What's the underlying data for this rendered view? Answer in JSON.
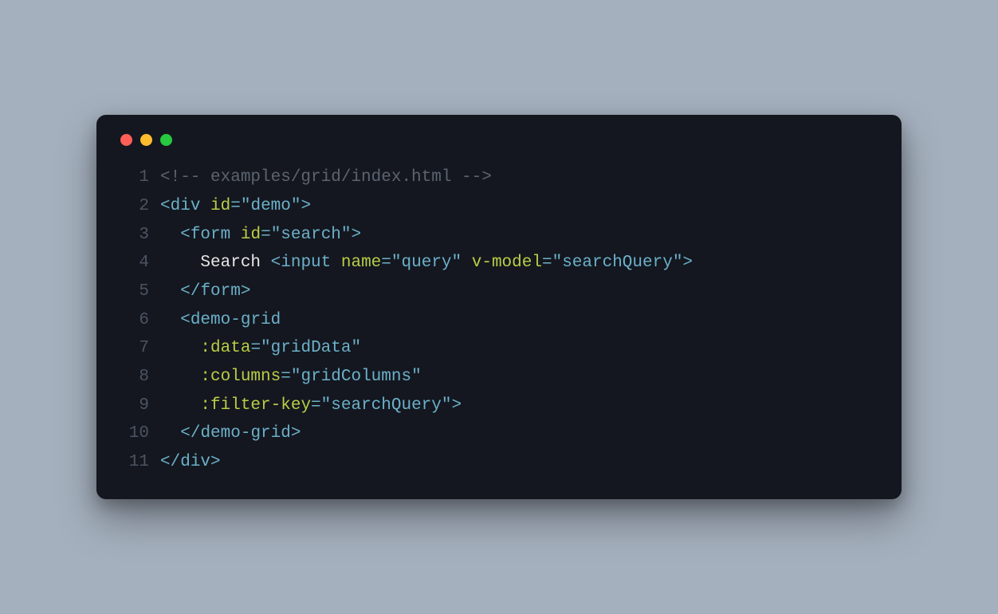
{
  "lines": [
    {
      "n": "1",
      "tokens": [
        {
          "c": "tok-comment",
          "t": "<!-- examples/grid/index.html -->"
        }
      ]
    },
    {
      "n": "2",
      "tokens": [
        {
          "c": "tok-punct",
          "t": "<"
        },
        {
          "c": "tok-tag",
          "t": "div"
        },
        {
          "c": "",
          "t": " "
        },
        {
          "c": "tok-attr",
          "t": "id"
        },
        {
          "c": "tok-punct",
          "t": "="
        },
        {
          "c": "tok-punct",
          "t": "\""
        },
        {
          "c": "tok-string",
          "t": "demo"
        },
        {
          "c": "tok-punct",
          "t": "\""
        },
        {
          "c": "tok-punct",
          "t": ">"
        }
      ]
    },
    {
      "n": "3",
      "tokens": [
        {
          "c": "",
          "t": "  "
        },
        {
          "c": "tok-punct",
          "t": "<"
        },
        {
          "c": "tok-tag",
          "t": "form"
        },
        {
          "c": "",
          "t": " "
        },
        {
          "c": "tok-attr",
          "t": "id"
        },
        {
          "c": "tok-punct",
          "t": "="
        },
        {
          "c": "tok-punct",
          "t": "\""
        },
        {
          "c": "tok-string",
          "t": "search"
        },
        {
          "c": "tok-punct",
          "t": "\""
        },
        {
          "c": "tok-punct",
          "t": ">"
        }
      ]
    },
    {
      "n": "4",
      "tokens": [
        {
          "c": "",
          "t": "    "
        },
        {
          "c": "tok-text",
          "t": "Search "
        },
        {
          "c": "tok-punct",
          "t": "<"
        },
        {
          "c": "tok-tag",
          "t": "input"
        },
        {
          "c": "",
          "t": " "
        },
        {
          "c": "tok-attr",
          "t": "name"
        },
        {
          "c": "tok-punct",
          "t": "="
        },
        {
          "c": "tok-punct",
          "t": "\""
        },
        {
          "c": "tok-string",
          "t": "query"
        },
        {
          "c": "tok-punct",
          "t": "\""
        },
        {
          "c": "",
          "t": " "
        },
        {
          "c": "tok-attr",
          "t": "v-model"
        },
        {
          "c": "tok-punct",
          "t": "="
        },
        {
          "c": "tok-punct",
          "t": "\""
        },
        {
          "c": "tok-string",
          "t": "searchQuery"
        },
        {
          "c": "tok-punct",
          "t": "\""
        },
        {
          "c": "tok-punct",
          "t": ">"
        }
      ]
    },
    {
      "n": "5",
      "tokens": [
        {
          "c": "",
          "t": "  "
        },
        {
          "c": "tok-punct",
          "t": "</"
        },
        {
          "c": "tok-tag",
          "t": "form"
        },
        {
          "c": "tok-punct",
          "t": ">"
        }
      ]
    },
    {
      "n": "6",
      "tokens": [
        {
          "c": "",
          "t": "  "
        },
        {
          "c": "tok-punct",
          "t": "<"
        },
        {
          "c": "tok-tag",
          "t": "demo-grid"
        }
      ]
    },
    {
      "n": "7",
      "tokens": [
        {
          "c": "",
          "t": "    "
        },
        {
          "c": "tok-attr",
          "t": ":data"
        },
        {
          "c": "tok-punct",
          "t": "="
        },
        {
          "c": "tok-punct",
          "t": "\""
        },
        {
          "c": "tok-string",
          "t": "gridData"
        },
        {
          "c": "tok-punct",
          "t": "\""
        }
      ]
    },
    {
      "n": "8",
      "tokens": [
        {
          "c": "",
          "t": "    "
        },
        {
          "c": "tok-attr",
          "t": ":columns"
        },
        {
          "c": "tok-punct",
          "t": "="
        },
        {
          "c": "tok-punct",
          "t": "\""
        },
        {
          "c": "tok-string",
          "t": "gridColumns"
        },
        {
          "c": "tok-punct",
          "t": "\""
        }
      ]
    },
    {
      "n": "9",
      "tokens": [
        {
          "c": "",
          "t": "    "
        },
        {
          "c": "tok-attr",
          "t": ":filter-key"
        },
        {
          "c": "tok-punct",
          "t": "="
        },
        {
          "c": "tok-punct",
          "t": "\""
        },
        {
          "c": "tok-string",
          "t": "searchQuery"
        },
        {
          "c": "tok-punct",
          "t": "\""
        },
        {
          "c": "tok-punct",
          "t": ">"
        }
      ]
    },
    {
      "n": "10",
      "tokens": [
        {
          "c": "",
          "t": "  "
        },
        {
          "c": "tok-punct",
          "t": "</"
        },
        {
          "c": "tok-tag",
          "t": "demo-grid"
        },
        {
          "c": "tok-punct",
          "t": ">"
        }
      ]
    },
    {
      "n": "11",
      "tokens": [
        {
          "c": "tok-punct",
          "t": "</"
        },
        {
          "c": "tok-tag",
          "t": "div"
        },
        {
          "c": "tok-punct",
          "t": ">"
        }
      ]
    }
  ]
}
